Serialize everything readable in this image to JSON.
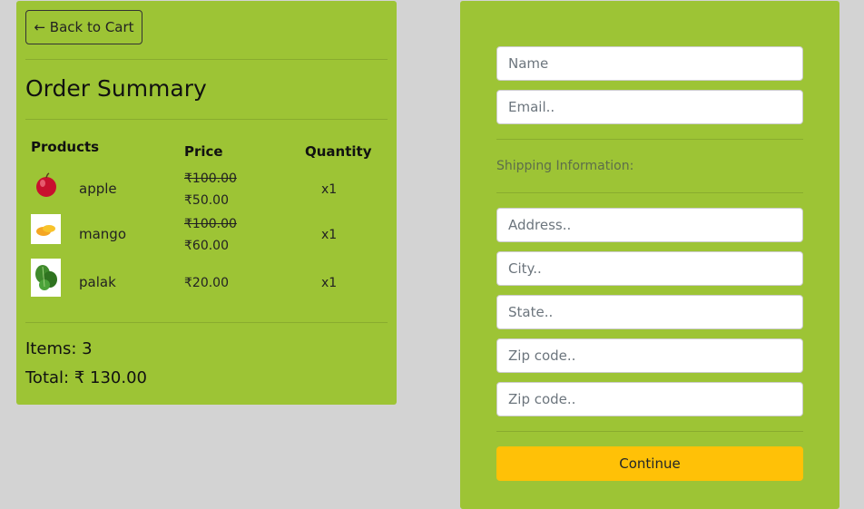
{
  "summary": {
    "back_label": "← Back to Cart",
    "title": "Order Summary",
    "columns": {
      "products": "Products",
      "price": "Price",
      "quantity": "Quantity"
    },
    "items": [
      {
        "name": "apple",
        "old_price": "₹100.00",
        "price": "₹50.00",
        "qty": "x1",
        "icon": "apple-image"
      },
      {
        "name": "mango",
        "old_price": "₹100.00",
        "price": "₹60.00",
        "qty": "x1",
        "icon": "mango-image"
      },
      {
        "name": "palak",
        "old_price": "",
        "price": "₹20.00",
        "qty": "x1",
        "icon": "palak-image"
      }
    ],
    "items_count": "Items: 3",
    "total": "Total: ₹ 130.00"
  },
  "form": {
    "name_placeholder": "Name",
    "email_placeholder": "Email..",
    "shipping_label": "Shipping Information:",
    "address_placeholder": "Address..",
    "city_placeholder": "City..",
    "state_placeholder": "State..",
    "zip_placeholder": "Zip code..",
    "zip2_placeholder": "Zip code..",
    "continue_label": "Continue"
  },
  "colors": {
    "panel": "#9dc435",
    "background": "#d3d3d3",
    "continue_button": "#ffc107"
  }
}
